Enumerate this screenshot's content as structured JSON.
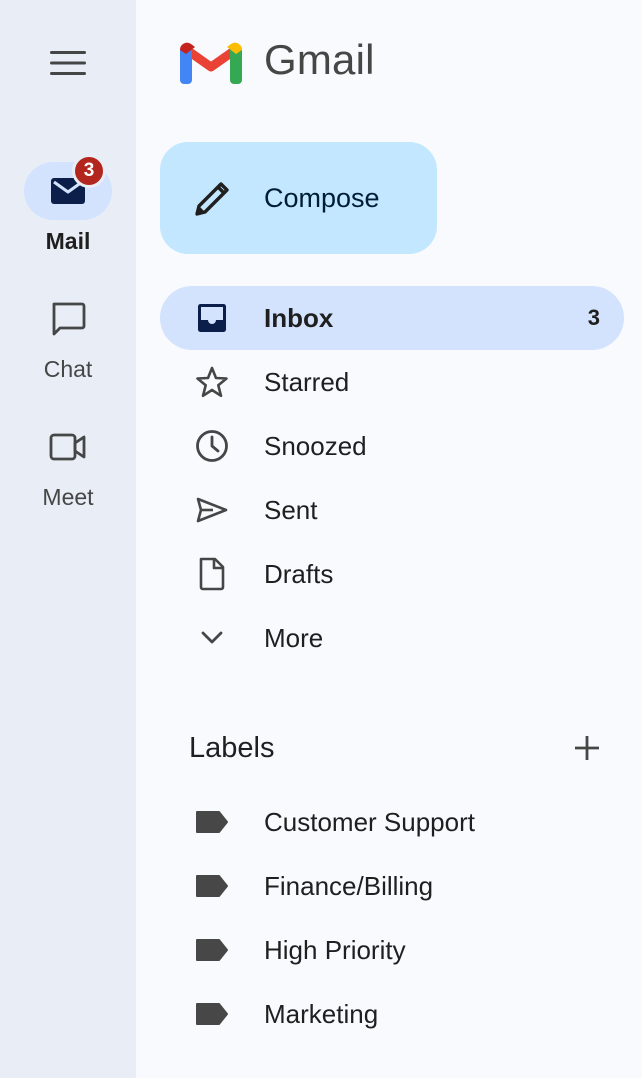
{
  "app": {
    "name": "Gmail"
  },
  "rail": {
    "items": [
      {
        "label": "Mail",
        "badge": "3",
        "icon": "mail-icon",
        "active": true
      },
      {
        "label": "Chat",
        "icon": "chat-icon",
        "active": false
      },
      {
        "label": "Meet",
        "icon": "video-icon",
        "active": false
      }
    ]
  },
  "compose": {
    "label": "Compose",
    "icon": "pencil-icon"
  },
  "nav": {
    "items": [
      {
        "label": "Inbox",
        "count": "3",
        "icon": "inbox-icon",
        "active": true
      },
      {
        "label": "Starred",
        "icon": "star-icon"
      },
      {
        "label": "Snoozed",
        "icon": "clock-icon"
      },
      {
        "label": "Sent",
        "icon": "send-icon"
      },
      {
        "label": "Drafts",
        "icon": "draft-icon"
      },
      {
        "label": "More",
        "icon": "chevron-down-icon"
      }
    ]
  },
  "labels": {
    "title": "Labels",
    "items": [
      {
        "label": "Customer Support",
        "icon": "label-icon"
      },
      {
        "label": "Finance/Billing",
        "icon": "label-icon"
      },
      {
        "label": "High Priority",
        "icon": "label-icon"
      },
      {
        "label": "Marketing",
        "icon": "label-icon"
      }
    ]
  },
  "colors": {
    "rail_bg": "#e9eef6",
    "page_bg": "#f8fafd",
    "compose_bg": "#c2e7ff",
    "active_bg": "#d3e3fd",
    "badge": "#b3261e"
  }
}
